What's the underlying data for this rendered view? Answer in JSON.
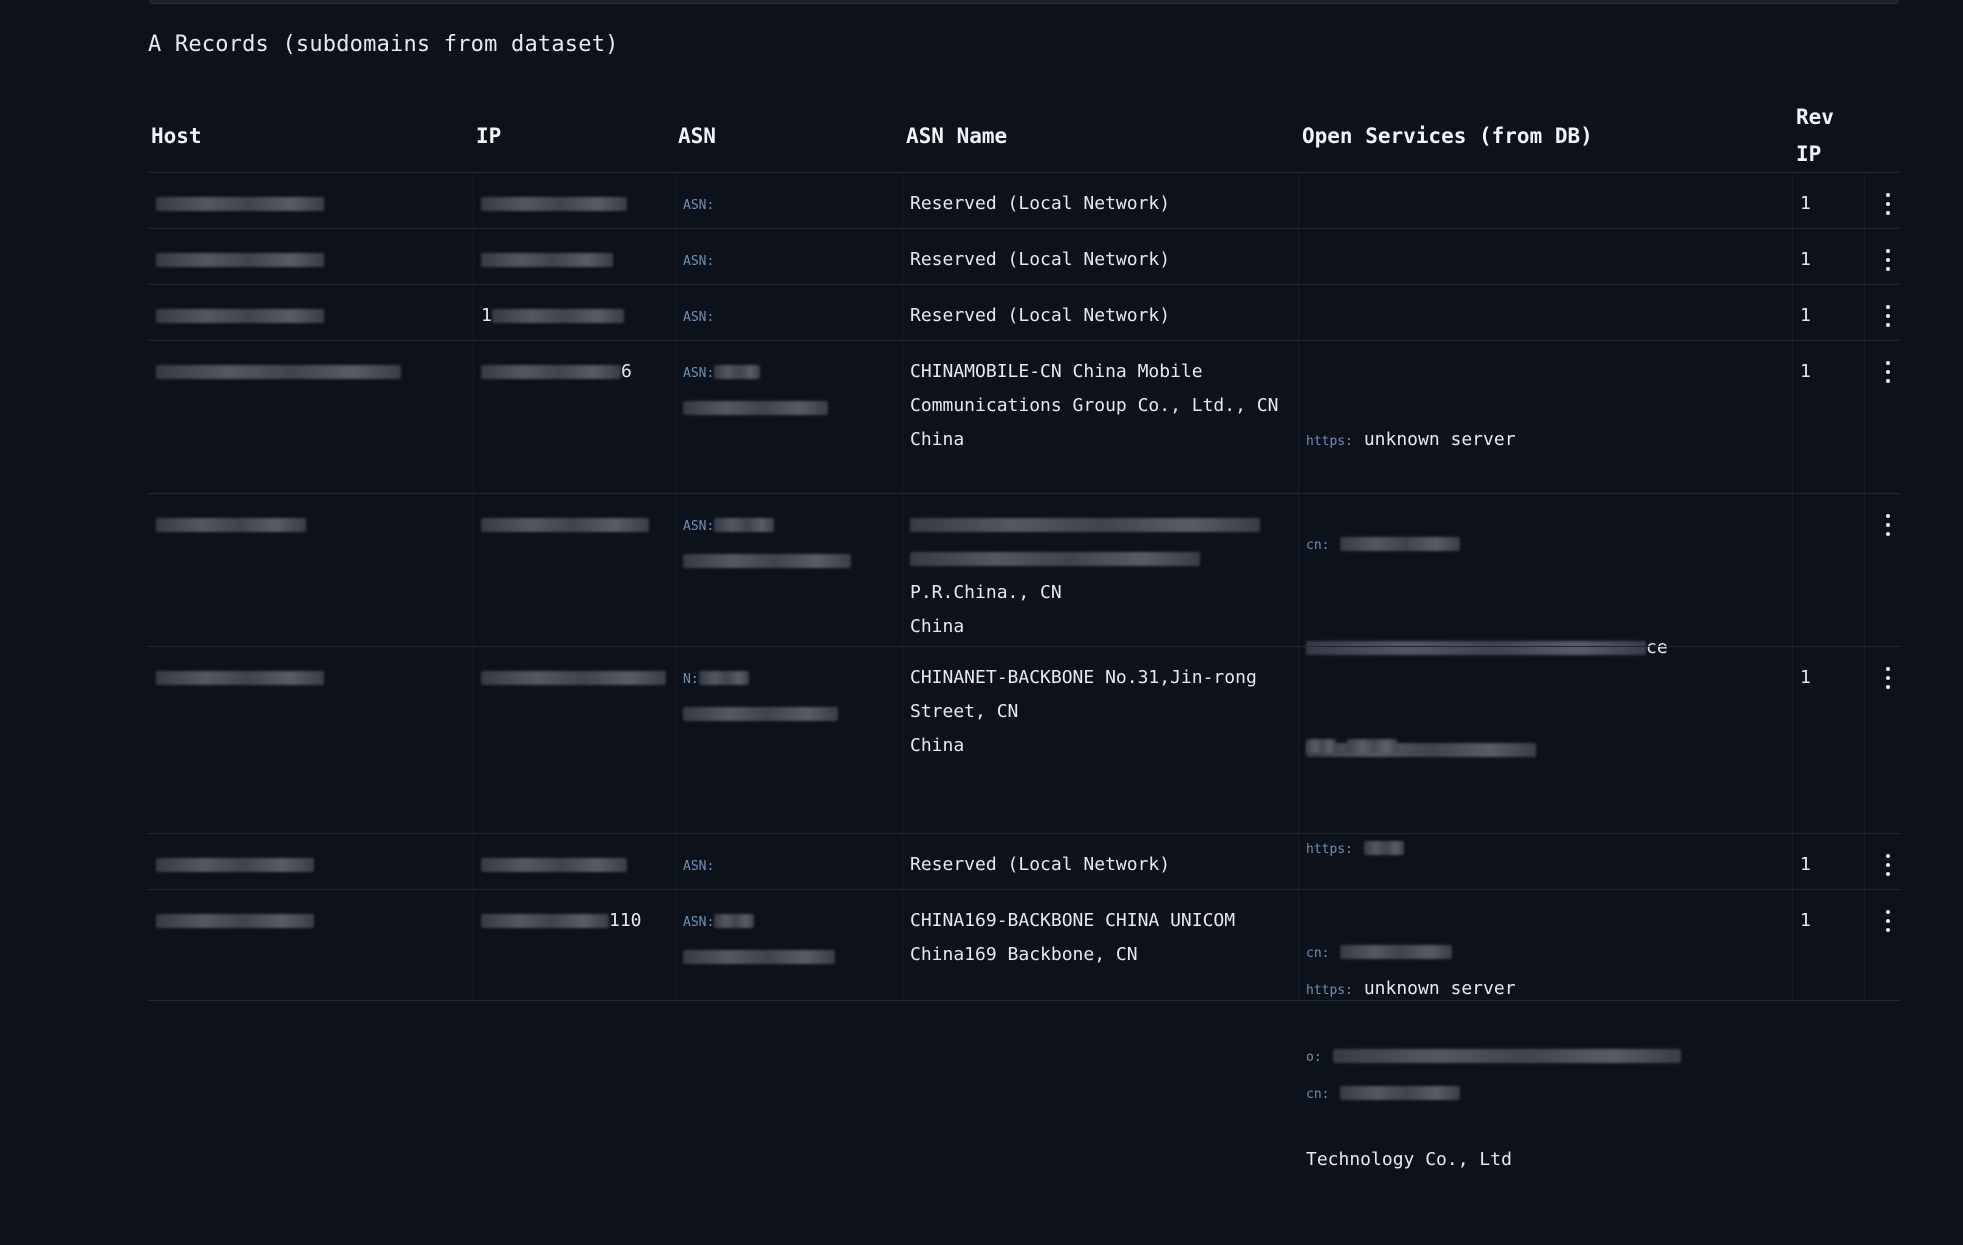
{
  "section": {
    "title": "A Records (subdomains from dataset)"
  },
  "table": {
    "headers": {
      "host": "Host",
      "ip": "IP",
      "asn": "ASN",
      "asn_name": "ASN Name",
      "open_services": "Open Services (from DB)",
      "revip": "RevIP"
    },
    "rows": [
      {
        "asn_label": "ASN:",
        "asn_name_lines": [
          "Reserved (Local Network)"
        ],
        "services": [],
        "revip": "1"
      },
      {
        "asn_label": "ASN:",
        "asn_name_lines": [
          "Reserved (Local Network)"
        ],
        "services": [],
        "revip": "1"
      },
      {
        "ip_fragment": "1",
        "asn_label": "ASN:",
        "asn_name_lines": [
          "Reserved (Local Network)"
        ],
        "services": [],
        "revip": "1"
      },
      {
        "ip_fragment": "6",
        "asn_label": "ASN:",
        "asn_name_lines": [
          "CHINAMOBILE-CN China Mobile",
          "Communications Group Co., Ltd., CN",
          "China"
        ],
        "services": [
          {
            "label": "https:",
            "value": "unknown server"
          },
          {
            "label": "cn:",
            "value": ""
          }
        ],
        "service_tail": "ce",
        "revip": "1"
      },
      {
        "asn_label": "ASN:",
        "asn_name_lines": [
          "P.R.China., CN",
          "China"
        ],
        "services": [],
        "revip": ""
      },
      {
        "asn_label": "N:",
        "asn_name_lines": [
          "CHINANET-BACKBONE No.31,Jin-rong",
          "Street, CN",
          "China"
        ],
        "services": [
          {
            "label": "https:",
            "value": ""
          },
          {
            "label": "cn:",
            "value": ""
          },
          {
            "label": "o:",
            "value": ""
          }
        ],
        "service_tail": "Technology Co., Ltd",
        "revip": "1"
      },
      {
        "asn_label": "ASN:",
        "asn_name_lines": [
          "Reserved (Local Network)"
        ],
        "services": [],
        "revip": "1"
      },
      {
        "ip_fragment": "110",
        "asn_label": "ASN:",
        "asn_name_lines": [
          "CHINA169-BACKBONE CHINA UNICOM",
          "China169 Backbone, CN"
        ],
        "services": [
          {
            "label": "https:",
            "value": "unknown server"
          },
          {
            "label": "cn:",
            "value": ""
          }
        ],
        "revip": "1"
      }
    ]
  },
  "icons": {
    "row_menu": "vertical-ellipsis-icon"
  },
  "colors": {
    "background": "#0d111a",
    "text": "#e6e9ef",
    "label": "#6e8db8"
  }
}
